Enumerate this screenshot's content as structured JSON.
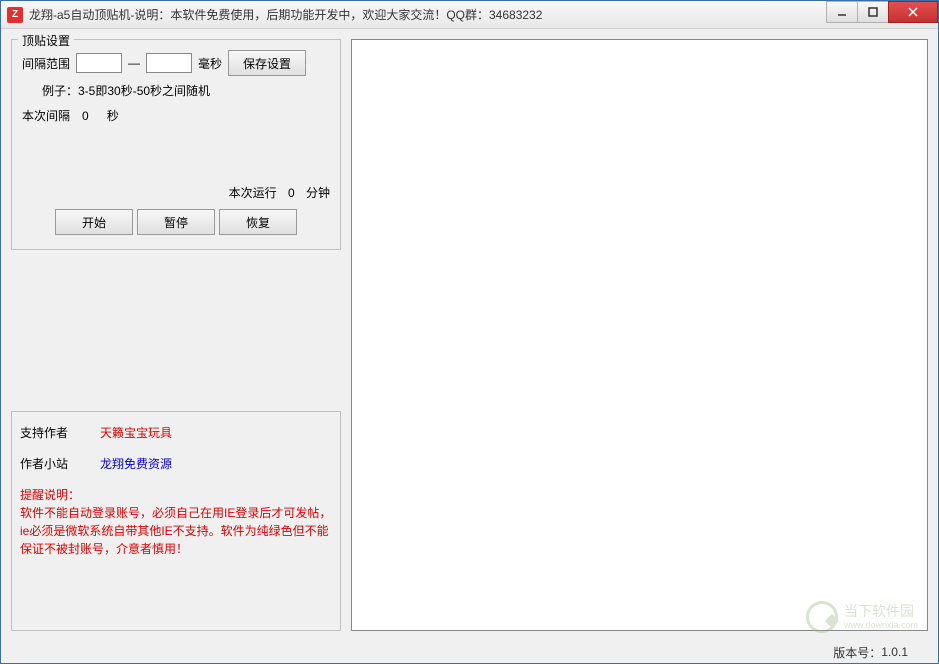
{
  "window": {
    "title": "龙翔-a5自动顶贴机-说明：本软件免费使用，后期功能开发中，欢迎大家交流！QQ群：34683232",
    "icon_text": "Z"
  },
  "settings": {
    "legend": "顶贴设置",
    "interval_label": "间隔范围",
    "interval_min": "",
    "interval_max": "",
    "dash": "—",
    "unit_ms": "毫秒",
    "save_btn": "保存设置",
    "example": "例子：3-5即30秒-50秒之间随机",
    "this_interval_label": "本次间隔",
    "this_interval_value": "0",
    "this_interval_unit": "秒",
    "runtime_label": "本次运行",
    "runtime_value": "0",
    "runtime_unit": "分钟",
    "start_btn": "开始",
    "pause_btn": "暂停",
    "resume_btn": "恢复"
  },
  "info": {
    "support_label": "支持作者",
    "support_link": "天籁宝宝玩具",
    "site_label": "作者小站",
    "site_link": "龙翔免费资源",
    "warning_title": "提醒说明：",
    "warning_text": "软件不能自动登录账号，必须自己在用IE登录后才可发帖，ie必须是微软系统自带其他IE不支持。软件为纯绿色但不能保证不被封账号，介意者慎用！"
  },
  "footer": {
    "version_label": "版本号：",
    "version_value": "1.0.1"
  },
  "watermark": {
    "name": "当下软件园",
    "url": "www.downxia.com"
  }
}
